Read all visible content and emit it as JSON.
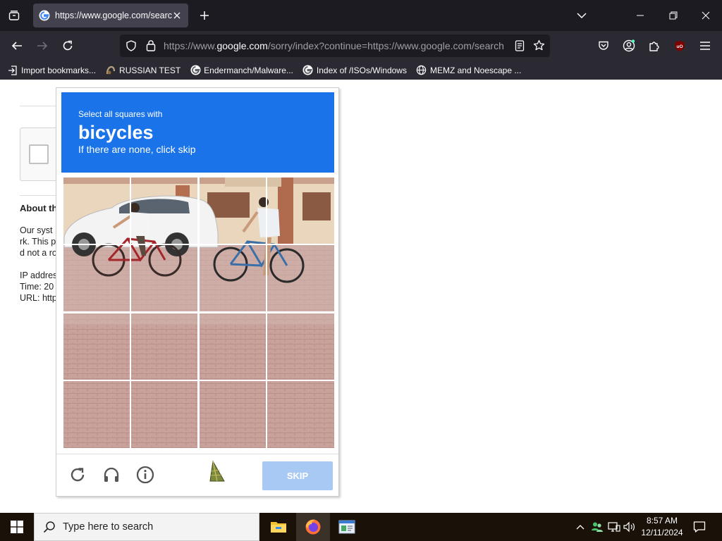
{
  "browser": {
    "tab_title": "https://www.google.com/search",
    "url_prefix": "https://www.",
    "url_domain": "google.com",
    "url_rest": "/sorry/index?continue=https://www.google.com/search",
    "bookmarks": [
      {
        "label": "Import bookmarks...",
        "icon": "import-icon"
      },
      {
        "label": "RUSSIAN TEST",
        "icon": "site-icon"
      },
      {
        "label": "Endermanch/Malware...",
        "icon": "google-icon"
      },
      {
        "label": "Index of /ISOs/Windows",
        "icon": "google-icon"
      },
      {
        "label": "MEMZ and Noescape ...",
        "icon": "globe-icon"
      }
    ]
  },
  "page": {
    "about_title": "About th",
    "lines": [
      "Our syst",
      "rk. This p",
      "d not a ro",
      "IP addres",
      "Time: 20",
      "URL: http"
    ]
  },
  "challenge": {
    "instruction_small": "Select all squares with",
    "instruction_target": "bicycles",
    "instruction_sub": "If there are none, click skip",
    "skip_label": "SKIP",
    "grid_rows": 4,
    "grid_cols": 4
  },
  "taskbar": {
    "search_placeholder": "Type here to search",
    "time": "8:57 AM",
    "date": "12/11/2024"
  },
  "colors": {
    "challenge_header": "#1a73e8",
    "skip_button": "#a9c9f5"
  }
}
